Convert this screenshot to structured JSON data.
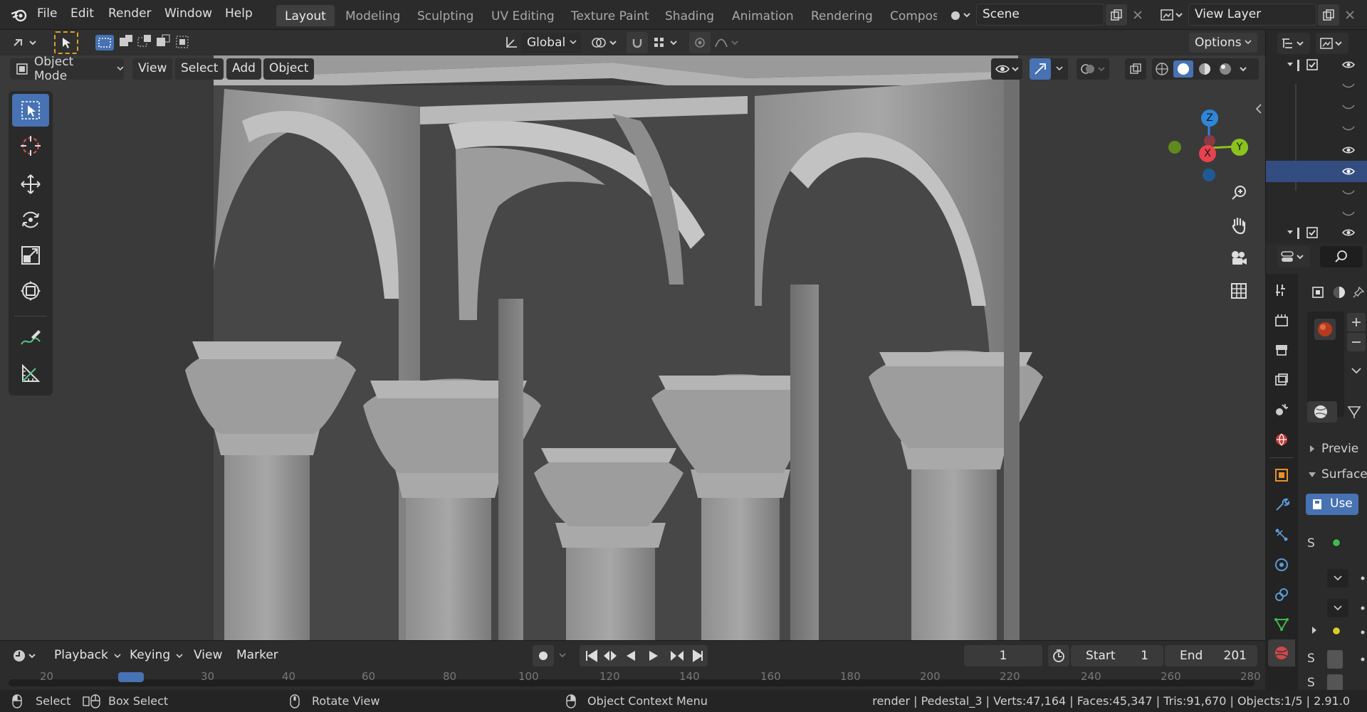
{
  "menu": {
    "file": "File",
    "edit": "Edit",
    "render": "Render",
    "window": "Window",
    "help": "Help"
  },
  "workspaces": [
    "Layout",
    "Modeling",
    "Sculpting",
    "UV Editing",
    "Texture Paint",
    "Shading",
    "Animation",
    "Rendering",
    "Compos"
  ],
  "scene": {
    "name": "Scene",
    "view_layer": "View Layer"
  },
  "toolbar": {
    "orientation": "Global",
    "options": "Options"
  },
  "viewport_header": {
    "mode": "Object Mode",
    "view": "View",
    "select": "Select",
    "add": "Add",
    "object": "Object"
  },
  "gizmo": {
    "x": "X",
    "y": "Y",
    "z": "Z"
  },
  "timeline": {
    "playback": "Playback",
    "keying": "Keying",
    "view": "View",
    "marker": "Marker",
    "current_frame": "1",
    "start_label": "Start",
    "start": "1",
    "end_label": "End",
    "end": "201",
    "ticks": [
      "20",
      "30",
      "40",
      "60",
      "80",
      "100",
      "120",
      "140",
      "160",
      "180",
      "200",
      "220",
      "240",
      "260",
      "280"
    ]
  },
  "properties": {
    "preview": "Previe",
    "surface": "Surface",
    "use_nodes": "Use",
    "s1": "S",
    "s2": "S",
    "s3": "S"
  },
  "status": {
    "select": "Select",
    "box_select": "Box Select",
    "rotate_view": "Rotate View",
    "context_menu": "Object Context Menu",
    "info": "render | Pedestal_3 | Verts:47,164 | Faces:45,347 | Tris:91,670 | Objects:1/5 | 2.91.0"
  },
  "colors": {
    "accent": "#4772b3",
    "axis_x": "#e8424f",
    "axis_y": "#8bc21e",
    "axis_z": "#2f86d6"
  }
}
